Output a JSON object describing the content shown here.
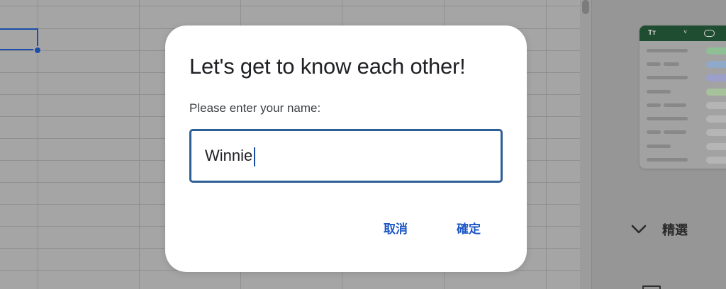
{
  "dialog": {
    "title": "Let's get to know each other!",
    "prompt_label": "Please enter your name:",
    "name_input_value": "Winnie",
    "cancel_label": "取消",
    "ok_label": "確定"
  },
  "side_panel": {
    "preview_header_text": "Tт",
    "preview_caret": "˅",
    "section_label": "精選"
  },
  "colors": {
    "accent": "#1a56c5",
    "input_border": "#2c5f96",
    "selection": "#1a4ea8",
    "preview_header": "#1f4d31",
    "chip_green": "#8fbf95",
    "chip_blue": "#8fa9c9",
    "chip_purple": "#9b9fc9",
    "chip_lightgreen": "#a6c29a",
    "chip_gray": "#b5b5b5"
  },
  "icons": {
    "featured_toggle": "chevron-down-icon",
    "preview_chip": "chip-icon"
  }
}
